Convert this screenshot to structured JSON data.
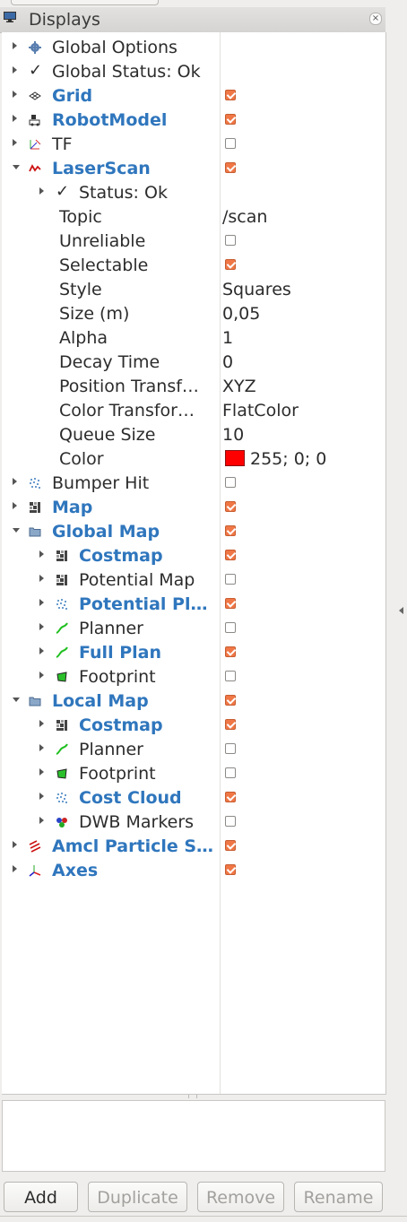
{
  "panel": {
    "title": "Displays",
    "close": "×"
  },
  "rows": [
    {
      "label": "Global Options",
      "blue": false,
      "indent": 0,
      "arrow": "right",
      "icon": "gear-icon"
    },
    {
      "label": "Global Status: Ok",
      "blue": false,
      "indent": 0,
      "arrow": "right",
      "icon": "check-icon"
    },
    {
      "label": "Grid",
      "blue": true,
      "indent": 0,
      "arrow": "right",
      "icon": "grid-icon",
      "checked": true
    },
    {
      "label": "RobotModel",
      "blue": true,
      "indent": 0,
      "arrow": "right",
      "icon": "robot-icon",
      "checked": true
    },
    {
      "label": "TF",
      "blue": false,
      "indent": 0,
      "arrow": "right",
      "icon": "tf-icon",
      "checked": false
    },
    {
      "label": "LaserScan",
      "blue": true,
      "indent": 0,
      "arrow": "down",
      "icon": "laser-icon",
      "checked": true
    },
    {
      "label": "Status: Ok",
      "blue": false,
      "indent": 1,
      "arrow": "right",
      "icon": "check-icon"
    },
    {
      "label": "Topic",
      "indent": 2,
      "value": "/scan"
    },
    {
      "label": "Unreliable",
      "indent": 2,
      "checked": false
    },
    {
      "label": "Selectable",
      "indent": 2,
      "checked": true
    },
    {
      "label": "Style",
      "indent": 2,
      "value": "Squares"
    },
    {
      "label": "Size (m)",
      "indent": 2,
      "value": "0,05"
    },
    {
      "label": "Alpha",
      "indent": 2,
      "value": "1"
    },
    {
      "label": "Decay Time",
      "indent": 2,
      "value": "0"
    },
    {
      "label": "Position Transf…",
      "indent": 2,
      "value": "XYZ"
    },
    {
      "label": "Color Transfor…",
      "indent": 2,
      "value": "FlatColor"
    },
    {
      "label": "Queue Size",
      "indent": 2,
      "value": "10"
    },
    {
      "label": "Color",
      "indent": 2,
      "value": "255; 0; 0",
      "swatch": "#ff0000"
    },
    {
      "label": "Bumper Hit",
      "blue": false,
      "indent": 0,
      "arrow": "right",
      "icon": "pointcloud-icon",
      "checked": false
    },
    {
      "label": "Map",
      "blue": true,
      "indent": 0,
      "arrow": "right",
      "icon": "map-icon",
      "checked": true
    },
    {
      "label": "Global Map",
      "blue": true,
      "indent": 0,
      "arrow": "down",
      "icon": "folder-icon",
      "checked": true
    },
    {
      "label": "Costmap",
      "blue": true,
      "indent": 1,
      "arrow": "right",
      "icon": "map-icon",
      "checked": true
    },
    {
      "label": "Potential Map",
      "blue": false,
      "indent": 1,
      "arrow": "right",
      "icon": "map-icon",
      "checked": false
    },
    {
      "label": "Potential Pl…",
      "blue": true,
      "indent": 1,
      "arrow": "right",
      "icon": "pointcloud-icon",
      "checked": true
    },
    {
      "label": "Planner",
      "blue": false,
      "indent": 1,
      "arrow": "right",
      "icon": "path-icon",
      "checked": false
    },
    {
      "label": "Full Plan",
      "blue": true,
      "indent": 1,
      "arrow": "right",
      "icon": "path-icon",
      "checked": true
    },
    {
      "label": "Footprint",
      "blue": false,
      "indent": 1,
      "arrow": "right",
      "icon": "polygon-icon",
      "checked": false
    },
    {
      "label": "Local Map",
      "blue": true,
      "indent": 0,
      "arrow": "down",
      "icon": "folder-icon",
      "checked": true
    },
    {
      "label": "Costmap",
      "blue": true,
      "indent": 1,
      "arrow": "right",
      "icon": "map-icon",
      "checked": true
    },
    {
      "label": "Planner",
      "blue": false,
      "indent": 1,
      "arrow": "right",
      "icon": "path-icon",
      "checked": false
    },
    {
      "label": "Footprint",
      "blue": false,
      "indent": 1,
      "arrow": "right",
      "icon": "polygon-icon",
      "checked": false
    },
    {
      "label": "Cost Cloud",
      "blue": true,
      "indent": 1,
      "arrow": "right",
      "icon": "pointcloud-icon",
      "checked": true
    },
    {
      "label": "DWB Markers",
      "blue": false,
      "indent": 1,
      "arrow": "right",
      "icon": "markers-icon",
      "checked": false
    },
    {
      "label": "Amcl Particle S…",
      "blue": true,
      "indent": 0,
      "arrow": "right",
      "icon": "particle-icon",
      "checked": true
    },
    {
      "label": "Axes",
      "blue": true,
      "indent": 0,
      "arrow": "right",
      "icon": "axes-icon",
      "checked": true
    }
  ],
  "buttons": {
    "add": "Add",
    "duplicate": "Duplicate",
    "remove": "Remove",
    "rename": "Rename"
  },
  "colors": {
    "accent": "#f07746",
    "link": "#2f76bd"
  }
}
